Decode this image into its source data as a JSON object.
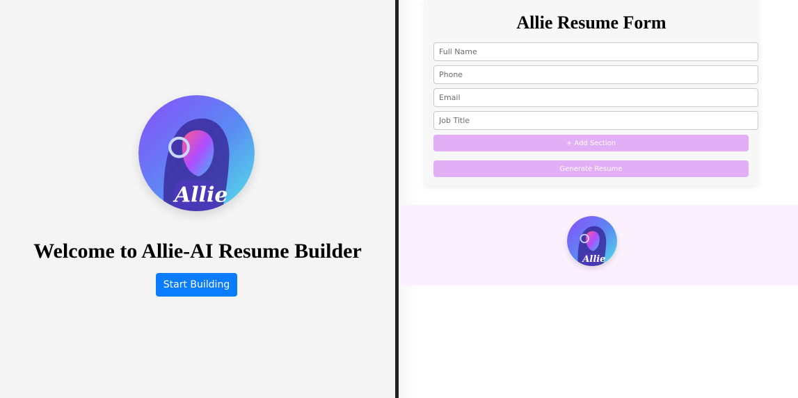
{
  "left": {
    "avatar_text": "Allie",
    "welcome_title": "Welcome to Allie-AI Resume Builder",
    "start_button_label": "Start Building"
  },
  "form": {
    "title": "Allie Resume Form",
    "fields": [
      {
        "placeholder": "Full Name",
        "value": ""
      },
      {
        "placeholder": "Phone",
        "value": ""
      },
      {
        "placeholder": "Email",
        "value": ""
      },
      {
        "placeholder": "Job Title",
        "value": ""
      }
    ],
    "add_section_label": "+ Add Section",
    "generate_label": "Generate Resume"
  },
  "footer": {
    "avatar_text": "Allie"
  },
  "colors": {
    "primary_button": "#0a7cff",
    "accent_purple": "#e2aef5",
    "left_background": "#f4f4f5",
    "footer_background": "#fbf0fd"
  }
}
